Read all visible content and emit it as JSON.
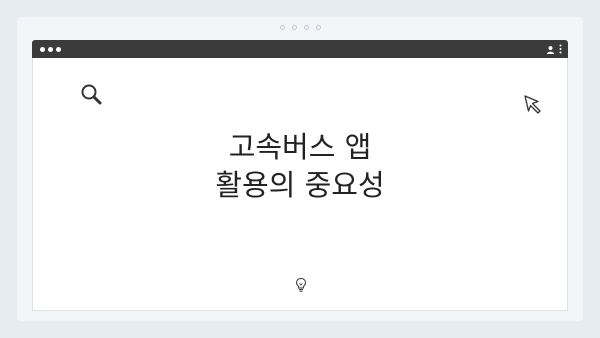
{
  "slide": {
    "title_line1": "고속버스 앱",
    "title_line2": "활용의 중요성"
  },
  "icons": {
    "window_controls": [
      "close-dot",
      "minimize-dot",
      "maximize-dot"
    ],
    "toolbar_right": [
      "account-icon",
      "more-vert-icon"
    ],
    "decorations": [
      "search-icon",
      "cursor-icon",
      "bulb-icon"
    ]
  },
  "pager": {
    "count": 4
  },
  "colors": {
    "background": "#e7ecf2",
    "card": "#f3f5f8",
    "titlebar": "#3b3b3b",
    "text": "#222222"
  }
}
